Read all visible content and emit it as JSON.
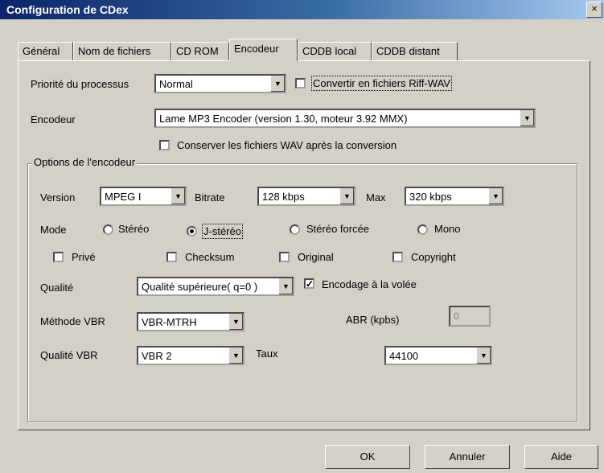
{
  "window": {
    "title": "Configuration de CDex",
    "close_glyph": "×"
  },
  "tabs": [
    {
      "label": "Général"
    },
    {
      "label": "Nom de fichiers"
    },
    {
      "label": "CD ROM"
    },
    {
      "label": "Encodeur",
      "active": true
    },
    {
      "label": "CDDB local"
    },
    {
      "label": "CDDB distant"
    }
  ],
  "priority": {
    "label": "Priorité du processus",
    "value": "Normal"
  },
  "riff_wav": {
    "label": "Convertir en fichiers Riff-WAV",
    "checked": false
  },
  "encoder": {
    "label": "Encodeur",
    "value": "Lame MP3 Encoder (version 1.30, moteur 3.92 MMX)"
  },
  "keep_wav": {
    "label": "Conserver les fichiers WAV après la conversion",
    "checked": false
  },
  "options": {
    "title": "Options de l'encodeur",
    "version": {
      "label": "Version",
      "value": "MPEG I"
    },
    "bitrate": {
      "label": "Bitrate",
      "value": "128 kbps"
    },
    "max": {
      "label": "Max",
      "value": "320 kbps"
    },
    "mode": {
      "label": "Mode",
      "options": [
        "Stéréo",
        "J-stéréo",
        "Stéréo forcée",
        "Mono"
      ],
      "selected": "J-stéréo"
    },
    "flags": [
      {
        "label": "Privé",
        "checked": false
      },
      {
        "label": "Checksum",
        "checked": false
      },
      {
        "label": "Original",
        "checked": false
      },
      {
        "label": "Copyright",
        "checked": false
      }
    ],
    "quality": {
      "label": "Qualité",
      "value": "Qualité supérieure( q=0 )"
    },
    "on_the_fly": {
      "label": "Encodage à la volée",
      "checked": true,
      "mark": "✓"
    },
    "vbr_method": {
      "label": "Méthode VBR",
      "value": "VBR-MTRH"
    },
    "abr": {
      "label": "ABR (kpbs)",
      "value": "0"
    },
    "vbr_quality": {
      "label": "Qualité VBR",
      "value": "VBR 2"
    },
    "rate": {
      "label": "Taux",
      "value": "44100"
    }
  },
  "buttons": {
    "ok": "OK",
    "cancel": "Annuler",
    "help": "Aide"
  },
  "arrow_glyph": "▼"
}
